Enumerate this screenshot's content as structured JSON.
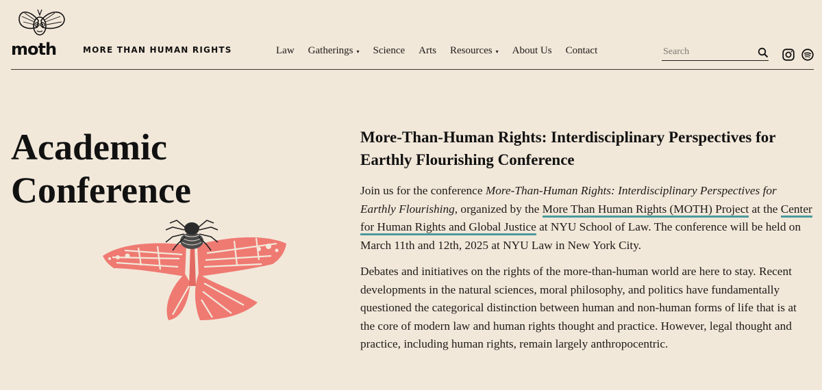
{
  "header": {
    "logo_word": "moth",
    "site_name": "MORE THAN HUMAN RIGHTS",
    "nav": [
      {
        "label": "Law",
        "has_dropdown": false
      },
      {
        "label": "Gatherings",
        "has_dropdown": true
      },
      {
        "label": "Science",
        "has_dropdown": false
      },
      {
        "label": "Arts",
        "has_dropdown": false
      },
      {
        "label": "Resources",
        "has_dropdown": true
      },
      {
        "label": "About Us",
        "has_dropdown": false
      },
      {
        "label": "Contact",
        "has_dropdown": false
      }
    ],
    "caret": "▾",
    "search_placeholder": "Search",
    "icons": [
      "search-icon",
      "instagram-icon",
      "spotify-icon"
    ]
  },
  "page": {
    "title_line1": "Academic",
    "title_line2": "Conference"
  },
  "article": {
    "title": "More-Than-Human Rights: Interdisciplinary Perspectives for Earthly Flourishing Conference",
    "p1": {
      "t1": "Join us for the conference ",
      "em": "More-Than-Human Rights: Interdisciplinary Perspectives for Earthly Flourishing",
      "t2": ", organized by the ",
      "link1": "More Than Human Rights (MOTH) Project",
      "t3": " at the ",
      "link2": "Center for Human Rights and Global Justice",
      "t4": " at NYU School of Law. The conference will be held on March 11th and 12th, 2025 at NYU Law in New York City."
    },
    "p2": "Debates and initiatives on the rights of the more-than-human world are here to stay. Recent developments in the natural sciences, moral philosophy, and politics have fundamentally questioned the categorical distinction between human and non-human forms of life that is at the core of modern law and human rights thought and practice. However, legal thought and practice, including human rights, remain largely anthropocentric."
  },
  "colors": {
    "background": "#f2e8da",
    "link_underline": "#4a9a9d",
    "moth_wing": "#ef7a72"
  }
}
